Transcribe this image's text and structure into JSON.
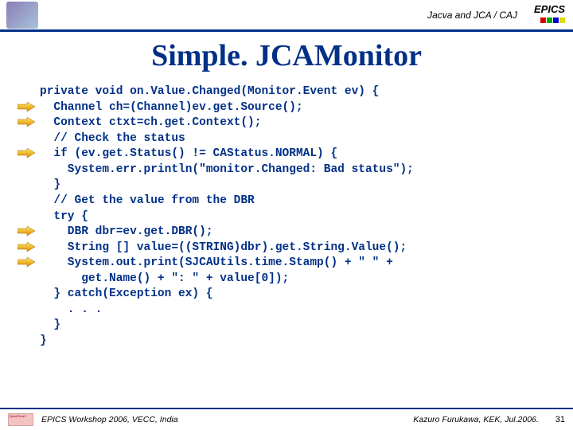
{
  "header": {
    "subject": "Jacva and JCA / CAJ",
    "brand": "EPICS"
  },
  "title": "Simple. JCAMonitor",
  "code": [
    {
      "indent": 0,
      "arrow": false,
      "text": "private void on.Value.Changed(Monitor.Event ev) {"
    },
    {
      "indent": 1,
      "arrow": true,
      "text": "Channel ch=(Channel)ev.get.Source();"
    },
    {
      "indent": 1,
      "arrow": true,
      "text": "Context ctxt=ch.get.Context();"
    },
    {
      "indent": 1,
      "arrow": false,
      "text": "// Check the status"
    },
    {
      "indent": 1,
      "arrow": true,
      "text": "if (ev.get.Status() != CAStatus.NORMAL) {"
    },
    {
      "indent": 2,
      "arrow": false,
      "text": "System.err.println(\"monitor.Changed: Bad status\");"
    },
    {
      "indent": 1,
      "arrow": false,
      "text": "}"
    },
    {
      "indent": 1,
      "arrow": false,
      "text": "// Get the value from the DBR"
    },
    {
      "indent": 1,
      "arrow": false,
      "text": "try {"
    },
    {
      "indent": 2,
      "arrow": true,
      "text": "DBR dbr=ev.get.DBR();"
    },
    {
      "indent": 2,
      "arrow": true,
      "text": "String [] value=((STRING)dbr).get.String.Value();"
    },
    {
      "indent": 2,
      "arrow": true,
      "text": "System.out.print(SJCAUtils.time.Stamp() + \" \" +"
    },
    {
      "indent": 3,
      "arrow": false,
      "text": "get.Name() + \": \" + value[0]);"
    },
    {
      "indent": 1,
      "arrow": false,
      "text": "} catch(Exception ex) {"
    },
    {
      "indent": 2,
      "arrow": false,
      "text": ". . ."
    },
    {
      "indent": 1,
      "arrow": false,
      "text": "}"
    },
    {
      "indent": 0,
      "arrow": false,
      "text": "}"
    }
  ],
  "footer": {
    "left": "EPICS Workshop 2006, VECC, India",
    "right": "Kazuro Furukawa, KEK, Jul.2006.",
    "page": "31",
    "logo_alt": "QuickTime?"
  }
}
